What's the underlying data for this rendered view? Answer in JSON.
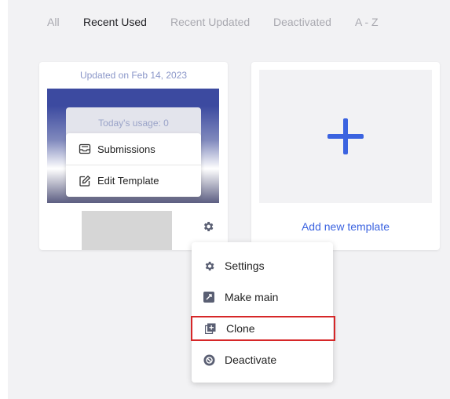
{
  "tabs": [
    {
      "label": "All",
      "active": false
    },
    {
      "label": "Recent Used",
      "active": true
    },
    {
      "label": "Recent Updated",
      "active": false
    },
    {
      "label": "Deactivated",
      "active": false
    },
    {
      "label": "A - Z",
      "active": false
    }
  ],
  "template_card": {
    "updated": "Updated on Feb 14, 2023",
    "usage": "Today's usage: 0",
    "menu": [
      {
        "label": "Submissions",
        "icon": "inbox-icon"
      },
      {
        "label": "Edit Template",
        "icon": "edit-icon"
      }
    ]
  },
  "add_card": {
    "label": "Add new template"
  },
  "dropdown": {
    "items": [
      {
        "label": "Settings",
        "icon": "gear-icon"
      },
      {
        "label": "Make main",
        "icon": "make-main-icon"
      },
      {
        "label": "Clone",
        "icon": "clone-icon",
        "highlighted": true
      },
      {
        "label": "Deactivate",
        "icon": "deactivate-icon"
      }
    ]
  },
  "colors": {
    "accent": "#3b63e0",
    "highlight_border": "#d62728",
    "icon_gray": "#5a5f73"
  }
}
